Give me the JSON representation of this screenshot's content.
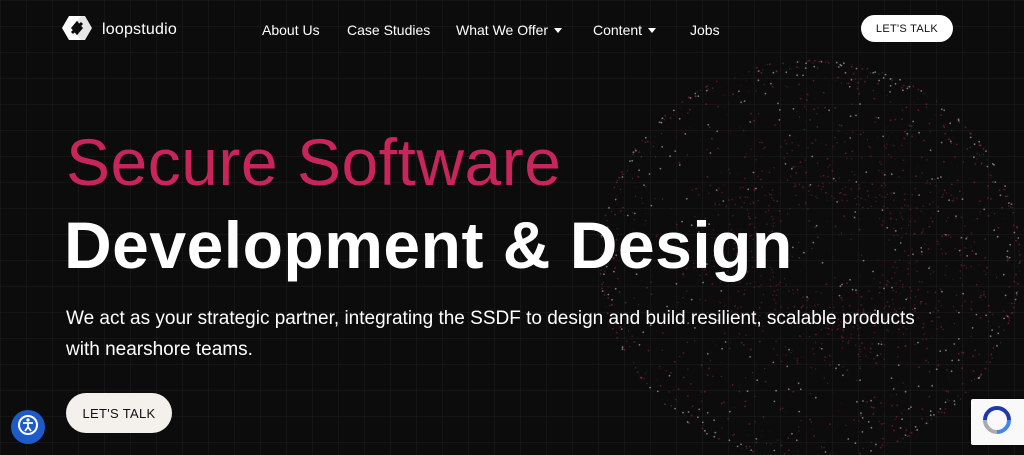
{
  "brand": {
    "name": "loopstudio"
  },
  "nav": {
    "items": [
      {
        "label": "About Us",
        "dropdown": false
      },
      {
        "label": "Case Studies",
        "dropdown": false
      },
      {
        "label": "What We Offer",
        "dropdown": true
      },
      {
        "label": "Content",
        "dropdown": true
      },
      {
        "label": "Jobs",
        "dropdown": false
      }
    ],
    "cta_label": "LET'S TALK"
  },
  "hero": {
    "title_line1": "Secure Software",
    "title_line2": "Development & Design",
    "subtitle": "We act as your strategic partner, integrating the SSDF to design and build resilient, scalable products with nearshore teams.",
    "cta_label": "LET'S TALK"
  },
  "colors": {
    "background": "#0d0c0d",
    "accent": "#c8255a",
    "text": "#ffffff",
    "button_bg": "#f4f1ec",
    "a11y_blue": "#1f5bc6"
  },
  "icons": {
    "logo": "loopstudio-logo-icon",
    "nav_dropdown": "caret-down-icon",
    "accessibility": "accessibility-icon",
    "recaptcha": "recaptcha-icon"
  }
}
